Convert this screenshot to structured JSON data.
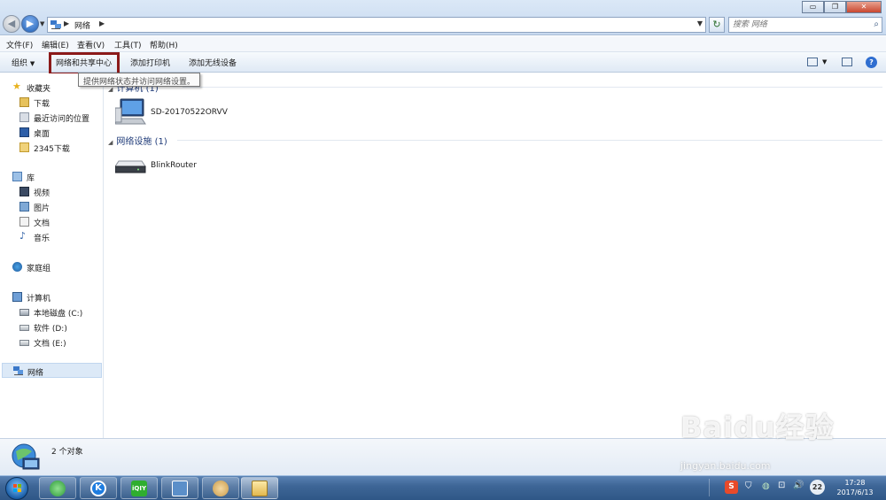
{
  "window": {
    "controls": {
      "minimize": "▭",
      "maximize": "❐",
      "close": "✕"
    }
  },
  "address": {
    "crumbs": [
      "网络"
    ],
    "search_placeholder": "搜索 网络"
  },
  "menu": [
    "文件(F)",
    "编辑(E)",
    "查看(V)",
    "工具(T)",
    "帮助(H)"
  ],
  "command_bar": {
    "organize": "组织",
    "network_sharing_center": "网络和共享中心",
    "add_printer": "添加打印机",
    "add_wireless_device": "添加无线设备"
  },
  "tooltip": "提供网络状态并访问网络设置。",
  "sidebar": {
    "favorites": {
      "label": "收藏夹",
      "items": [
        "下载",
        "最近访问的位置",
        "桌面",
        "2345下载"
      ]
    },
    "libraries": {
      "label": "库",
      "items": [
        "视频",
        "图片",
        "文档",
        "音乐"
      ]
    },
    "homegroup": "家庭组",
    "computer": {
      "label": "计算机",
      "items": [
        "本地磁盘 (C:)",
        "软件 (D:)",
        "文档 (E:)"
      ]
    },
    "network": "网络"
  },
  "groups": [
    {
      "header": "计算机 (1)",
      "items": [
        {
          "name": "SD-20170522ORVV",
          "icon": "computer-icon"
        }
      ]
    },
    {
      "header": "网络设施 (1)",
      "items": [
        {
          "name": "BlinkRouter",
          "icon": "router-icon"
        }
      ]
    }
  ],
  "status": {
    "text": "2 个对象"
  },
  "taskbar": {
    "clock_time": "17:28",
    "clock_date": "2017/6/13",
    "badge": "22",
    "apps": [
      "ie-icon",
      "kugou-icon",
      "iqiyi-icon",
      "network-app-icon",
      "paint-icon",
      "explorer-icon"
    ]
  },
  "watermark": {
    "brand": "Baidu经验",
    "url": "jingyan.baidu.com"
  },
  "colors": {
    "highlight": "#8b1a1a",
    "group_header": "#1e3a78",
    "selected_bg": "#dce9f7"
  }
}
